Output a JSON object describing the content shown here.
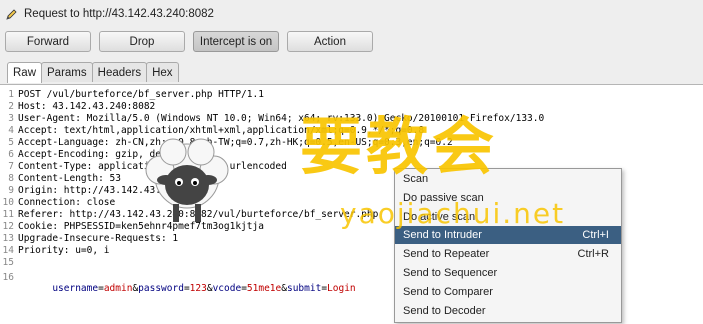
{
  "window": {
    "title": "Request to http://43.142.43.240:8082"
  },
  "toolbar": {
    "forward_label": "Forward",
    "drop_label": "Drop",
    "intercept_label": "Intercept is on",
    "action_label": "Action"
  },
  "tabs": [
    {
      "label": "Raw"
    },
    {
      "label": "Params"
    },
    {
      "label": "Headers"
    },
    {
      "label": "Hex"
    }
  ],
  "request_lines": [
    {
      "n": "1",
      "text": "POST /vul/burteforce/bf_server.php HTTP/1.1"
    },
    {
      "n": "2",
      "text": "Host: 43.142.43.240:8082"
    },
    {
      "n": "3",
      "text": "User-Agent: Mozilla/5.0 (Windows NT 10.0; Win64; x64; rv:133.0) Gecko/20100101 Firefox/133.0"
    },
    {
      "n": "4",
      "text": "Accept: text/html,application/xhtml+xml,application/xml;q=0.9,*/*;q=0.8"
    },
    {
      "n": "5",
      "text": "Accept-Language: zh-CN,zh;q=0.8,zh-TW;q=0.7,zh-HK;q=0.5,en-US;q=0.3,en;q=0.2"
    },
    {
      "n": "6",
      "text": "Accept-Encoding: gzip, deflate"
    },
    {
      "n": "7",
      "text": "Content-Type: application/x-www-form-urlencoded"
    },
    {
      "n": "8",
      "text": "Content-Length: 53"
    },
    {
      "n": "9",
      "text": "Origin: http://43.142.43.240:8082"
    },
    {
      "n": "10",
      "text": "Connection: close"
    },
    {
      "n": "11",
      "text": "Referer: http://43.142.43.240:8082/vul/burteforce/bf_server.php"
    },
    {
      "n": "12",
      "text": "Cookie: PHPSESSID=ken5ehnr4pmef7tm3og1kjtja"
    },
    {
      "n": "13",
      "text": "Upgrade-Insecure-Requests: 1"
    },
    {
      "n": "14",
      "text": "Priority: u=0, i"
    },
    {
      "n": "15",
      "text": ""
    }
  ],
  "body_line": {
    "n": "16",
    "params": [
      {
        "name": "username",
        "value": "admin"
      },
      {
        "name": "password",
        "value": "123"
      },
      {
        "name": "vcode",
        "value": "51me1e"
      },
      {
        "name": "submit",
        "value": "Login"
      }
    ]
  },
  "context_menu": {
    "items": [
      {
        "label": "Scan",
        "shortcut": ""
      },
      {
        "label": "Do passive scan",
        "shortcut": ""
      },
      {
        "label": "Do active scan",
        "shortcut": ""
      },
      {
        "label": "Send to Intruder",
        "shortcut": "Ctrl+I",
        "highlighted": true
      },
      {
        "label": "Send to Repeater",
        "shortcut": "Ctrl+R"
      },
      {
        "label": "Send to Sequencer",
        "shortcut": ""
      },
      {
        "label": "Send to Comparer",
        "shortcut": ""
      },
      {
        "label": "Send to Decoder",
        "shortcut": ""
      }
    ]
  },
  "watermark": {
    "cn": "要教会",
    "url": "yaojiachui.net"
  },
  "colors": {
    "highlight": "#3b5f82",
    "watermark": "#f8c400",
    "param_name": "#000080",
    "param_value": "#c00000"
  }
}
